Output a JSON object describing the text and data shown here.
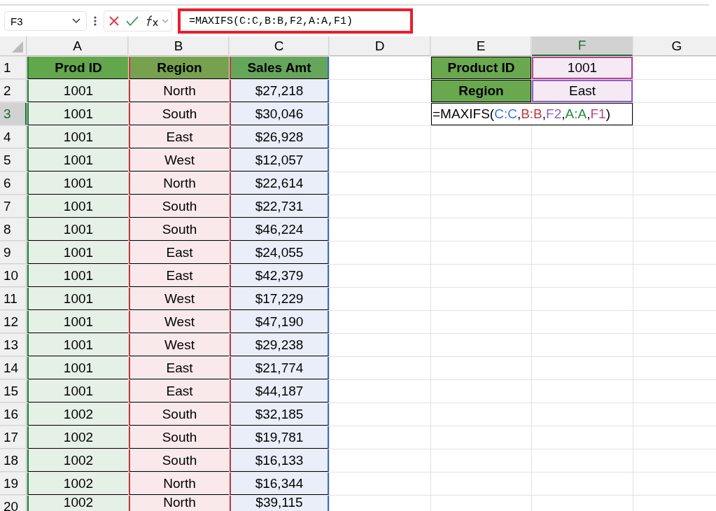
{
  "formula_bar": {
    "name_box": "F3",
    "formula": "=MAXIFS(C:C,B:B,F2,A:A,F1)"
  },
  "column_headers": [
    {
      "label": "A",
      "selected": false
    },
    {
      "label": "B",
      "selected": false
    },
    {
      "label": "C",
      "selected": false
    },
    {
      "label": "D",
      "selected": false
    },
    {
      "label": "E",
      "selected": false
    },
    {
      "label": "F",
      "selected": true
    },
    {
      "label": "G",
      "selected": false
    }
  ],
  "row_headers": [
    {
      "label": "1",
      "selected": false
    },
    {
      "label": "2",
      "selected": false
    },
    {
      "label": "3",
      "selected": true
    },
    {
      "label": "4",
      "selected": false
    },
    {
      "label": "5",
      "selected": false
    },
    {
      "label": "6",
      "selected": false
    },
    {
      "label": "7",
      "selected": false
    },
    {
      "label": "8",
      "selected": false
    },
    {
      "label": "9",
      "selected": false
    },
    {
      "label": "10",
      "selected": false
    },
    {
      "label": "11",
      "selected": false
    },
    {
      "label": "12",
      "selected": false
    },
    {
      "label": "13",
      "selected": false
    },
    {
      "label": "14",
      "selected": false
    },
    {
      "label": "15",
      "selected": false
    },
    {
      "label": "16",
      "selected": false
    },
    {
      "label": "17",
      "selected": false
    },
    {
      "label": "18",
      "selected": false
    },
    {
      "label": "19",
      "selected": false
    },
    {
      "label": "20",
      "selected": false
    }
  ],
  "table": {
    "columns": [
      {
        "label": "Prod ID"
      },
      {
        "label": "Region"
      },
      {
        "label": "Sales Amt"
      }
    ],
    "rows": [
      [
        "1001",
        "North",
        "$27,218"
      ],
      [
        "1001",
        "South",
        "$30,046"
      ],
      [
        "1001",
        "East",
        "$26,928"
      ],
      [
        "1001",
        "West",
        "$12,057"
      ],
      [
        "1001",
        "North",
        "$22,614"
      ],
      [
        "1001",
        "South",
        "$22,731"
      ],
      [
        "1001",
        "South",
        "$46,224"
      ],
      [
        "1001",
        "East",
        "$24,055"
      ],
      [
        "1001",
        "East",
        "$42,379"
      ],
      [
        "1001",
        "West",
        "$17,229"
      ],
      [
        "1001",
        "West",
        "$47,190"
      ],
      [
        "1001",
        "West",
        "$29,238"
      ],
      [
        "1001",
        "East",
        "$21,774"
      ],
      [
        "1001",
        "East",
        "$44,187"
      ],
      [
        "1002",
        "South",
        "$32,185"
      ],
      [
        "1002",
        "South",
        "$19,781"
      ],
      [
        "1002",
        "South",
        "$16,133"
      ],
      [
        "1002",
        "North",
        "$16,344"
      ],
      [
        "1002",
        "North",
        "$39,115"
      ]
    ]
  },
  "criteria": [
    {
      "label": "Product ID",
      "value": "1001",
      "color": "#b5478f"
    },
    {
      "label": "Region",
      "value": "East",
      "color": "#8e5fc6"
    }
  ],
  "editing_cell": {
    "segments": [
      {
        "text": "=MAXIFS("
      },
      {
        "text": "C:C",
        "color": "#3a78d8"
      },
      {
        "text": ","
      },
      {
        "text": "B:B",
        "color": "#c0393f"
      },
      {
        "text": ","
      },
      {
        "text": "F2",
        "color": "#8e5fc6"
      },
      {
        "text": ","
      },
      {
        "text": "A:A",
        "color": "#1f8a36"
      },
      {
        "text": ","
      },
      {
        "text": "F1",
        "color": "#b5478f"
      },
      {
        "text": ")"
      }
    ]
  }
}
